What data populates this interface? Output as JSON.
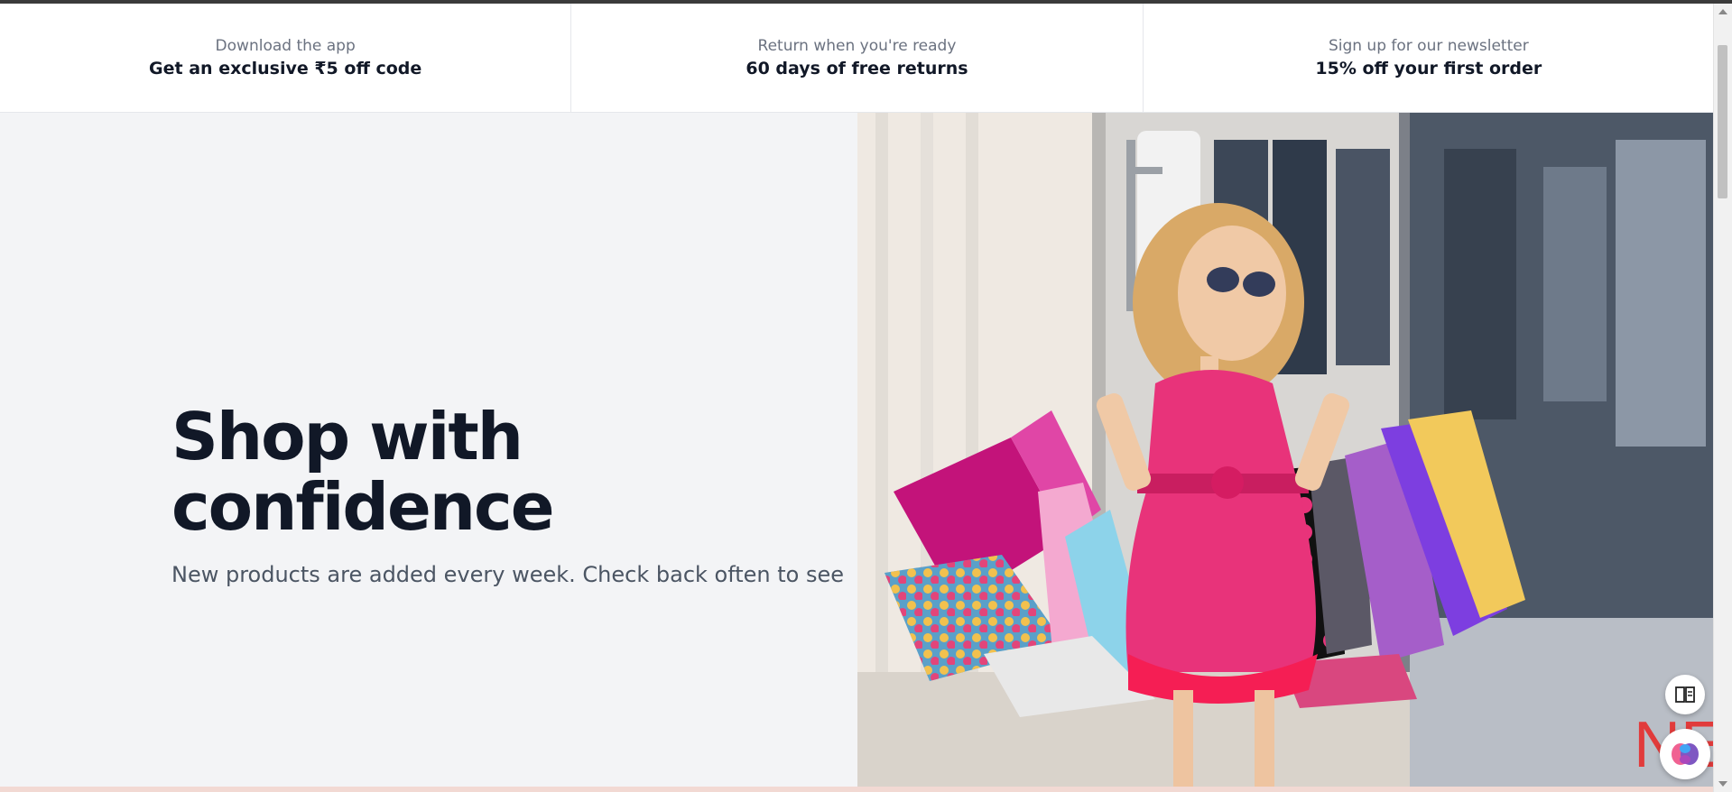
{
  "perks": [
    {
      "subtitle": "Download the app",
      "title": "Get an exclusive ₹5 off code"
    },
    {
      "subtitle": "Return when you're ready",
      "title": "60 days of free returns"
    },
    {
      "subtitle": "Sign up for our newsletter",
      "title": "15% off your first order"
    }
  ],
  "hero": {
    "title_line1": "Shop with",
    "title_line2": "confidence",
    "subtitle": "New products are added every week. Check back often to see"
  },
  "hero_image": {
    "description_icon": "girl-with-shopping-bags-photo",
    "store_sign_text": "NEW CO"
  },
  "floating_buttons": [
    {
      "icon": "reader-mode-icon"
    },
    {
      "icon": "brain-assistant-icon"
    }
  ],
  "colors": {
    "hero_bg": "#f3f4f6",
    "title": "#111827",
    "subtitle": "#4b5563",
    "dress_pink": "#e8337a"
  }
}
